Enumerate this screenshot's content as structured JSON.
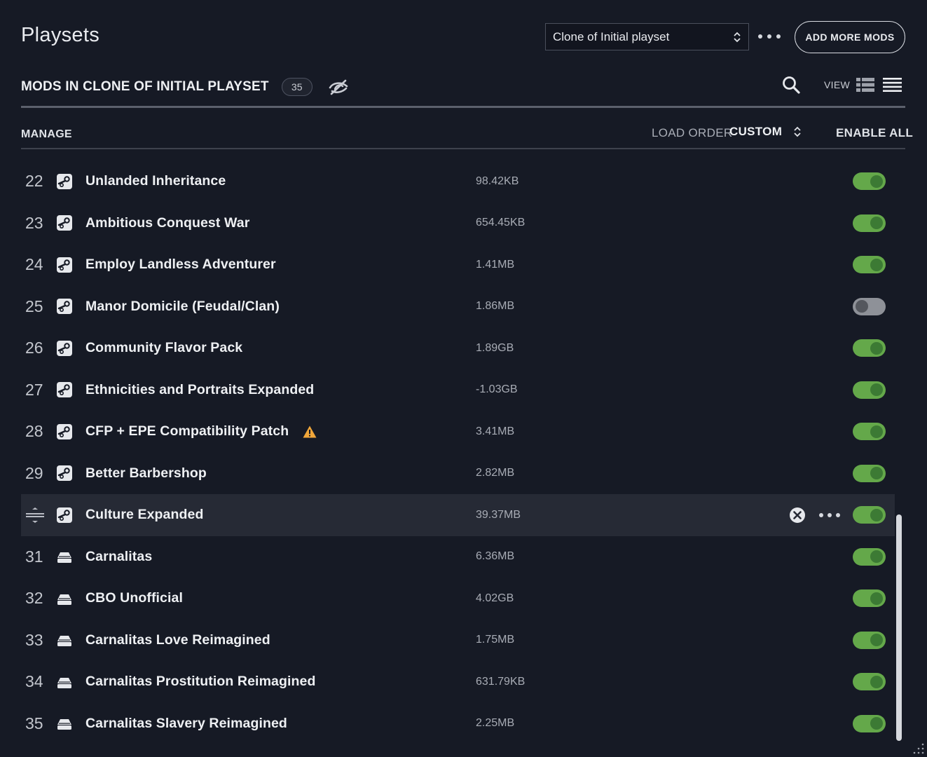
{
  "app": {
    "title": "Playsets"
  },
  "playset_select": {
    "value": "Clone of Initial playset"
  },
  "header": {
    "add_more_label": "ADD MORE MODS",
    "mods_title": "MODS IN CLONE OF INITIAL PLAYSET",
    "mod_count": "35",
    "view_label": "VIEW"
  },
  "toolbar": {
    "manage_label": "MANAGE",
    "load_order_label": "LOAD ORDER",
    "load_order_value": "CUSTOM",
    "enable_all_label": "ENABLE ALL"
  },
  "colors": {
    "background": "#161a25",
    "toggle_on": "#64a84a",
    "toggle_off": "#8e9198",
    "warning": "#f0a63a"
  },
  "mods": [
    {
      "index": "22",
      "name": "Unlanded Inheritance",
      "size": "98.42KB",
      "source": "steam-icon",
      "enabled": true
    },
    {
      "index": "23",
      "name": "Ambitious Conquest War",
      "size": "654.45KB",
      "source": "steam-icon",
      "enabled": true
    },
    {
      "index": "24",
      "name": "Employ Landless Adventurer",
      "size": "1.41MB",
      "source": "steam-icon",
      "enabled": true
    },
    {
      "index": "25",
      "name": "Manor Domicile (Feudal/Clan)",
      "size": "1.86MB",
      "source": "steam-icon",
      "enabled": false
    },
    {
      "index": "26",
      "name": "Community Flavor Pack",
      "size": "1.89GB",
      "source": "steam-icon",
      "enabled": true
    },
    {
      "index": "27",
      "name": "Ethnicities and Portraits Expanded",
      "size": "-1.03GB",
      "source": "steam-icon",
      "enabled": true
    },
    {
      "index": "28",
      "name": "CFP + EPE Compatibility Patch",
      "size": "3.41MB",
      "source": "steam-icon",
      "enabled": true,
      "warning": true
    },
    {
      "index": "29",
      "name": "Better Barbershop",
      "size": "2.82MB",
      "source": "steam-icon",
      "enabled": true
    },
    {
      "index": "",
      "name": "Culture Expanded",
      "size": "39.37MB",
      "source": "steam-icon",
      "enabled": true,
      "selected": true
    },
    {
      "index": "31",
      "name": "Carnalitas",
      "size": "6.36MB",
      "source": "local-drive-icon",
      "enabled": true
    },
    {
      "index": "32",
      "name": "CBO Unofficial",
      "size": "4.02GB",
      "source": "local-drive-icon",
      "enabled": true
    },
    {
      "index": "33",
      "name": "Carnalitas Love Reimagined",
      "size": "1.75MB",
      "source": "local-drive-icon",
      "enabled": true
    },
    {
      "index": "34",
      "name": "Carnalitas Prostitution Reimagined",
      "size": "631.79KB",
      "source": "local-drive-icon",
      "enabled": true
    },
    {
      "index": "35",
      "name": "Carnalitas Slavery Reimagined",
      "size": "2.25MB",
      "source": "local-drive-icon",
      "enabled": true
    }
  ]
}
